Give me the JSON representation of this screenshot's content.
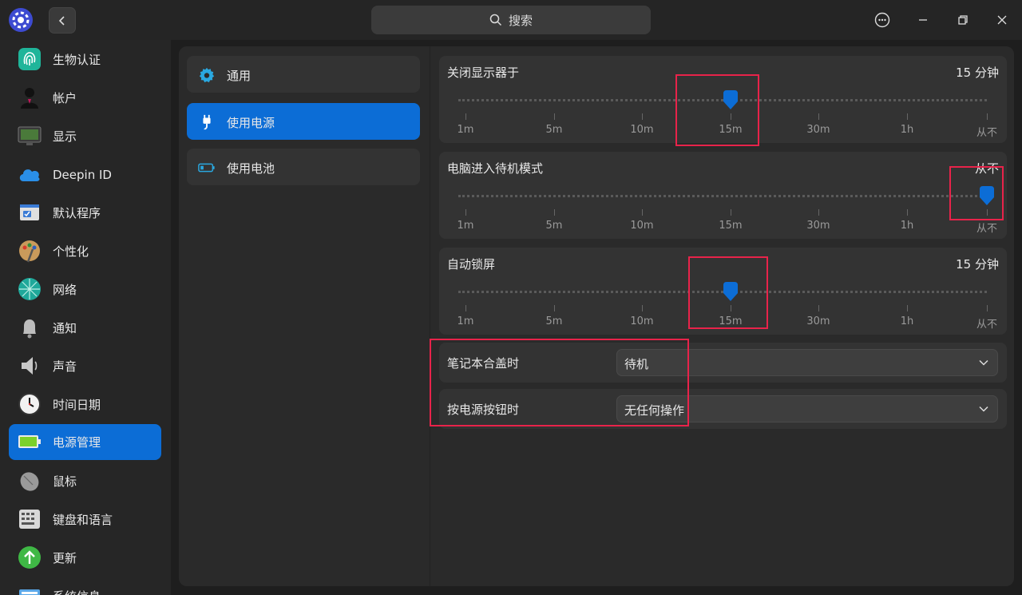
{
  "titlebar": {
    "search_placeholder": "搜索"
  },
  "sidebar": {
    "items": [
      {
        "label": "生物认证",
        "icon": "fingerprint-icon"
      },
      {
        "label": "帐户",
        "icon": "account-icon"
      },
      {
        "label": "显示",
        "icon": "display-icon"
      },
      {
        "label": "Deepin ID",
        "icon": "cloud-icon"
      },
      {
        "label": "默认程序",
        "icon": "default-apps-icon"
      },
      {
        "label": "个性化",
        "icon": "palette-icon"
      },
      {
        "label": "网络",
        "icon": "network-icon"
      },
      {
        "label": "通知",
        "icon": "bell-icon"
      },
      {
        "label": "声音",
        "icon": "speaker-icon"
      },
      {
        "label": "时间日期",
        "icon": "clock-icon"
      },
      {
        "label": "电源管理",
        "icon": "battery-icon",
        "active": true
      },
      {
        "label": "鼠标",
        "icon": "mouse-icon"
      },
      {
        "label": "键盘和语言",
        "icon": "keyboard-icon"
      },
      {
        "label": "更新",
        "icon": "update-icon"
      },
      {
        "label": "系统信息",
        "icon": "system-info-icon"
      }
    ]
  },
  "subnav": {
    "items": [
      {
        "label": "通用",
        "icon": "gear-icon"
      },
      {
        "label": "使用电源",
        "icon": "plug-icon",
        "active": true
      },
      {
        "label": "使用电池",
        "icon": "battery-icon"
      }
    ]
  },
  "sliders": {
    "tick_labels": [
      "1m",
      "5m",
      "10m",
      "15m",
      "30m",
      "1h",
      "从不"
    ],
    "items": [
      {
        "title": "关闭显示器于",
        "value": "15 分钟",
        "selected_index": 3
      },
      {
        "title": "电脑进入待机模式",
        "value": "从不",
        "selected_index": 6
      },
      {
        "title": "自动锁屏",
        "value": "15 分钟",
        "selected_index": 3
      }
    ]
  },
  "selects": {
    "lid": {
      "label": "笔记本合盖时",
      "value": "待机"
    },
    "power_button": {
      "label": "按电源按钮时",
      "value": "无任何操作"
    }
  },
  "colors": {
    "accent": "#0c6dd6",
    "annotation": "#e8234a"
  }
}
